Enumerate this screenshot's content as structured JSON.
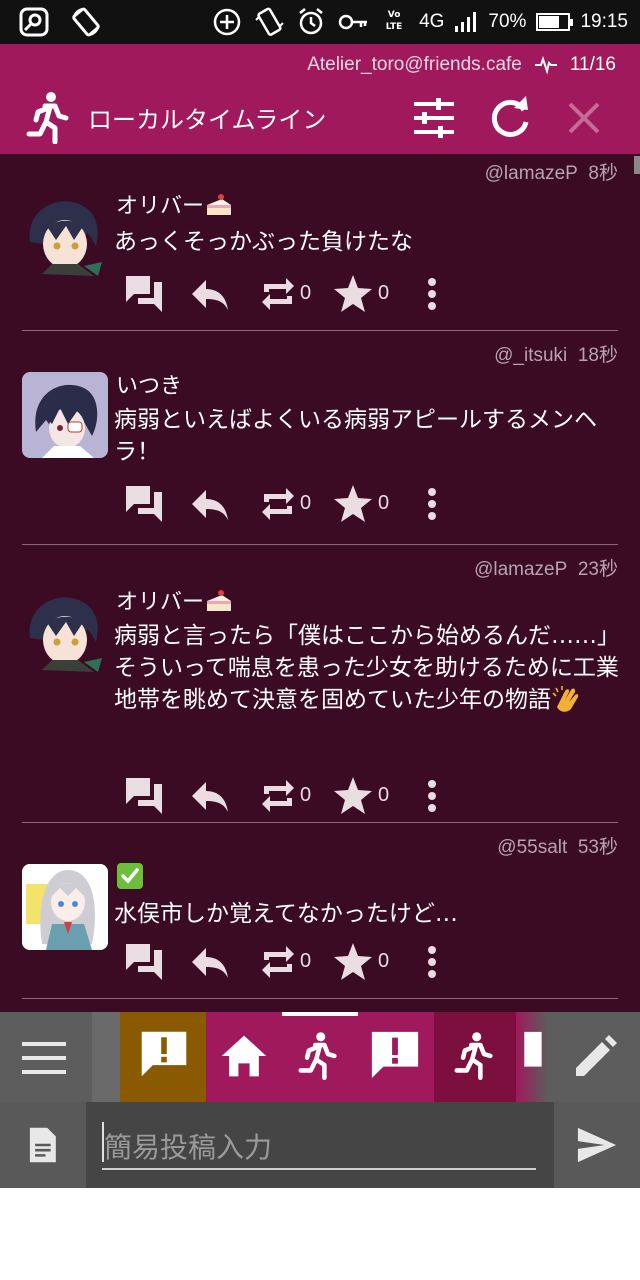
{
  "status_bar": {
    "battery": "70%",
    "battery_level": 0.7,
    "network": "4G",
    "volte": "Vo LTE",
    "time": "19:15"
  },
  "header": {
    "account": "Atelier_toro@friends.cafe",
    "column_position": "11/16",
    "title": "ローカルタイムライン"
  },
  "statuses": [
    {
      "acct": "@lamazeP",
      "time": "8秒",
      "name": "オリバー",
      "name_emoji": "cake",
      "body": "あっくそっかぶった負けたな",
      "boost_count": "0",
      "fav_count": "0",
      "avatar": "avatar-oliver"
    },
    {
      "acct": "@_itsuki",
      "time": "18秒",
      "name": "いつき",
      "body": "病弱といえばよくいる病弱アピールするメンヘラ！",
      "boost_count": "0",
      "fav_count": "0",
      "avatar": "avatar-itsuki"
    },
    {
      "acct": "@lamazeP",
      "time": "23秒",
      "name": "オリバー",
      "name_emoji": "cake",
      "body": "病弱と言ったら「僕はここから始めるんだ……」そういって喘息を患った少女を助けるために工業地帯を眺めて決意を固めていた少年の物語",
      "body_emoji": "clapping-hands",
      "boost_count": "0",
      "fav_count": "0",
      "avatar": "avatar-oliver"
    },
    {
      "acct": "@55salt",
      "time": "53秒",
      "name_emoji": "check-mark",
      "body": "水俣市しか覚えてなかったけど…",
      "boost_count": "0",
      "fav_count": "0",
      "avatar": "avatar-salt"
    }
  ],
  "post_bar": {
    "placeholder": "簡易投稿入力"
  },
  "colors": {
    "header": "#a0195c",
    "timeline_bg": "#3b0a23",
    "tab_orange": "#8a5a00",
    "tab_selected": "#a0195c",
    "tab_dark": "#7c0f3e"
  }
}
